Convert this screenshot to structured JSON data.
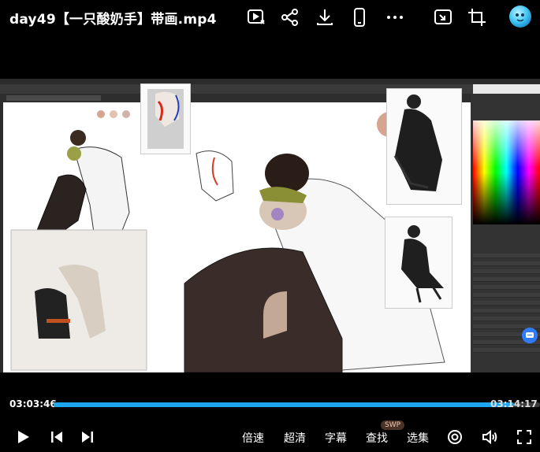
{
  "header": {
    "title": "day49【一只酸奶手】带画.mp4",
    "icons": [
      "play-list-icon",
      "share-icon",
      "download-icon",
      "phone-icon",
      "more-icon",
      "pip-icon",
      "crop-icon",
      "avatar-icon"
    ]
  },
  "video": {
    "app": "Photoshop",
    "canvas_tab": "",
    "accent": "#1ea7f0"
  },
  "progress": {
    "current": "03:03:46",
    "total": "03:14:17",
    "fraction": 0.946
  },
  "controls": {
    "items": [
      {
        "key": "speed",
        "label": "倍速"
      },
      {
        "key": "quality",
        "label": "超清"
      },
      {
        "key": "subtitle",
        "label": "字幕"
      },
      {
        "key": "search",
        "label": "查找"
      },
      {
        "key": "episodes",
        "label": "选集"
      }
    ],
    "swp_badge": "SWP"
  }
}
